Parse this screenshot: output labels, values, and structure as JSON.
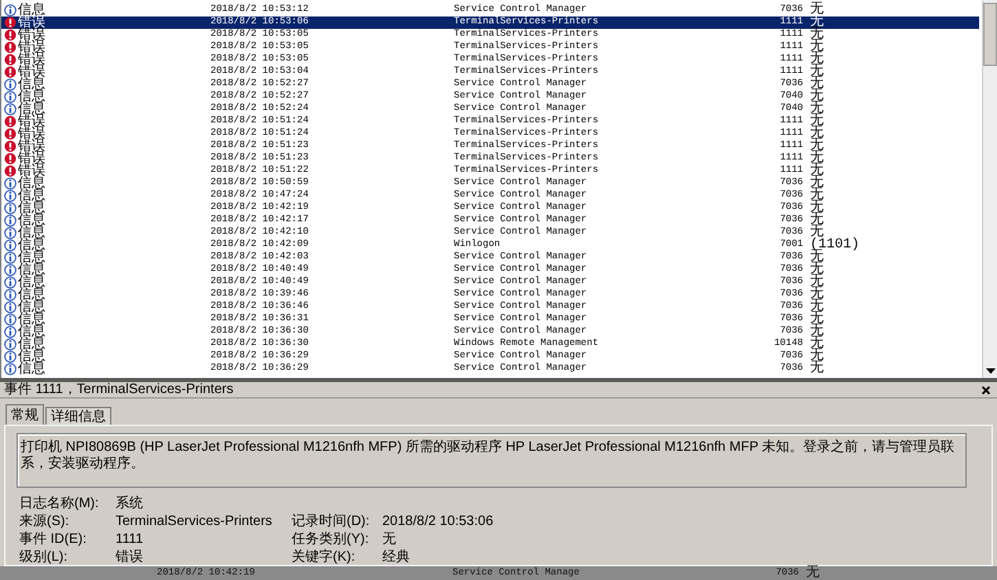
{
  "events": [
    {
      "kind": "info",
      "level": "信息",
      "time": "2018/8/2 10:53:12",
      "source": "Service Control Manager",
      "event_id": "7036",
      "task": "无",
      "selected": false
    },
    {
      "kind": "error",
      "level": "错误",
      "time": "2018/8/2 10:53:06",
      "source": "TerminalServices-Printers",
      "event_id": "1111",
      "task": "无",
      "selected": true
    },
    {
      "kind": "error",
      "level": "错误",
      "time": "2018/8/2 10:53:05",
      "source": "TerminalServices-Printers",
      "event_id": "1111",
      "task": "无",
      "selected": false
    },
    {
      "kind": "error",
      "level": "错误",
      "time": "2018/8/2 10:53:05",
      "source": "TerminalServices-Printers",
      "event_id": "1111",
      "task": "无",
      "selected": false
    },
    {
      "kind": "error",
      "level": "错误",
      "time": "2018/8/2 10:53:05",
      "source": "TerminalServices-Printers",
      "event_id": "1111",
      "task": "无",
      "selected": false
    },
    {
      "kind": "error",
      "level": "错误",
      "time": "2018/8/2 10:53:04",
      "source": "TerminalServices-Printers",
      "event_id": "1111",
      "task": "无",
      "selected": false
    },
    {
      "kind": "info",
      "level": "信息",
      "time": "2018/8/2 10:52:27",
      "source": "Service Control Manager",
      "event_id": "7036",
      "task": "无",
      "selected": false
    },
    {
      "kind": "info",
      "level": "信息",
      "time": "2018/8/2 10:52:27",
      "source": "Service Control Manager",
      "event_id": "7040",
      "task": "无",
      "selected": false
    },
    {
      "kind": "info",
      "level": "信息",
      "time": "2018/8/2 10:52:24",
      "source": "Service Control Manager",
      "event_id": "7040",
      "task": "无",
      "selected": false
    },
    {
      "kind": "error",
      "level": "错误",
      "time": "2018/8/2 10:51:24",
      "source": "TerminalServices-Printers",
      "event_id": "1111",
      "task": "无",
      "selected": false
    },
    {
      "kind": "error",
      "level": "错误",
      "time": "2018/8/2 10:51:24",
      "source": "TerminalServices-Printers",
      "event_id": "1111",
      "task": "无",
      "selected": false
    },
    {
      "kind": "error",
      "level": "错误",
      "time": "2018/8/2 10:51:23",
      "source": "TerminalServices-Printers",
      "event_id": "1111",
      "task": "无",
      "selected": false
    },
    {
      "kind": "error",
      "level": "错误",
      "time": "2018/8/2 10:51:23",
      "source": "TerminalServices-Printers",
      "event_id": "1111",
      "task": "无",
      "selected": false
    },
    {
      "kind": "error",
      "level": "错误",
      "time": "2018/8/2 10:51:22",
      "source": "TerminalServices-Printers",
      "event_id": "1111",
      "task": "无",
      "selected": false
    },
    {
      "kind": "info",
      "level": "信息",
      "time": "2018/8/2 10:50:59",
      "source": "Service Control Manager",
      "event_id": "7036",
      "task": "无",
      "selected": false
    },
    {
      "kind": "info",
      "level": "信息",
      "time": "2018/8/2 10:47:24",
      "source": "Service Control Manager",
      "event_id": "7036",
      "task": "无",
      "selected": false
    },
    {
      "kind": "info",
      "level": "信息",
      "time": "2018/8/2 10:42:19",
      "source": "Service Control Manager",
      "event_id": "7036",
      "task": "无",
      "selected": false
    },
    {
      "kind": "info",
      "level": "信息",
      "time": "2018/8/2 10:42:17",
      "source": "Service Control Manager",
      "event_id": "7036",
      "task": "无",
      "selected": false
    },
    {
      "kind": "info",
      "level": "信息",
      "time": "2018/8/2 10:42:10",
      "source": "Service Control Manager",
      "event_id": "7036",
      "task": "无",
      "selected": false
    },
    {
      "kind": "info",
      "level": "信息",
      "time": "2018/8/2 10:42:09",
      "source": "Winlogon",
      "event_id": "7001",
      "task": "(1101)",
      "selected": false
    },
    {
      "kind": "info",
      "level": "信息",
      "time": "2018/8/2 10:42:03",
      "source": "Service Control Manager",
      "event_id": "7036",
      "task": "无",
      "selected": false
    },
    {
      "kind": "info",
      "level": "信息",
      "time": "2018/8/2 10:40:49",
      "source": "Service Control Manager",
      "event_id": "7036",
      "task": "无",
      "selected": false
    },
    {
      "kind": "info",
      "level": "信息",
      "time": "2018/8/2 10:40:49",
      "source": "Service Control Manager",
      "event_id": "7036",
      "task": "无",
      "selected": false
    },
    {
      "kind": "info",
      "level": "信息",
      "time": "2018/8/2 10:39:46",
      "source": "Service Control Manager",
      "event_id": "7036",
      "task": "无",
      "selected": false
    },
    {
      "kind": "info",
      "level": "信息",
      "time": "2018/8/2 10:36:46",
      "source": "Service Control Manager",
      "event_id": "7036",
      "task": "无",
      "selected": false
    },
    {
      "kind": "info",
      "level": "信息",
      "time": "2018/8/2 10:36:31",
      "source": "Service Control Manager",
      "event_id": "7036",
      "task": "无",
      "selected": false
    },
    {
      "kind": "info",
      "level": "信息",
      "time": "2018/8/2 10:36:30",
      "source": "Service Control Manager",
      "event_id": "7036",
      "task": "无",
      "selected": false
    },
    {
      "kind": "info",
      "level": "信息",
      "time": "2018/8/2 10:36:30",
      "source": "Windows Remote Management",
      "event_id": "10148",
      "task": "无",
      "selected": false
    },
    {
      "kind": "info",
      "level": "信息",
      "time": "2018/8/2 10:36:29",
      "source": "Service Control Manager",
      "event_id": "7036",
      "task": "无",
      "selected": false
    },
    {
      "kind": "info",
      "level": "信息",
      "time": "2018/8/2 10:36:29",
      "source": "Service Control Manager",
      "event_id": "7036",
      "task": "无",
      "selected": false
    }
  ],
  "detail": {
    "title": "事件 1111，TerminalServices-Printers",
    "tabs": [
      {
        "label": "常规",
        "selected": true
      },
      {
        "label": "详细信息",
        "selected": false
      }
    ],
    "message": "打印机 NPI80869B (HP LaserJet Professional M1216nfh MFP) 所需的驱动程序 HP LaserJet Professional M1216nfh MFP 未知。登录之前，请与管理员联系，安装驱动程序。",
    "fields": [
      {
        "label": "日志名称(M):",
        "value": "系统"
      },
      {
        "label": "来源(S):",
        "value": "TerminalServices-Printers",
        "extra_label": "记录时间(D):",
        "extra_value": "2018/8/2 10:53:06"
      },
      {
        "label": "事件 ID(E):",
        "value": "1111",
        "extra_label": "任务类别(Y):",
        "extra_value": "无"
      },
      {
        "label": "级别(L):",
        "value": "错误",
        "extra_label": "关键字(K):",
        "extra_value": "经典"
      }
    ]
  },
  "bottom_row": {
    "time": "2018/8/2 10:42:19",
    "source": "Service Control Manage",
    "event_id": "7036",
    "task": "无"
  }
}
